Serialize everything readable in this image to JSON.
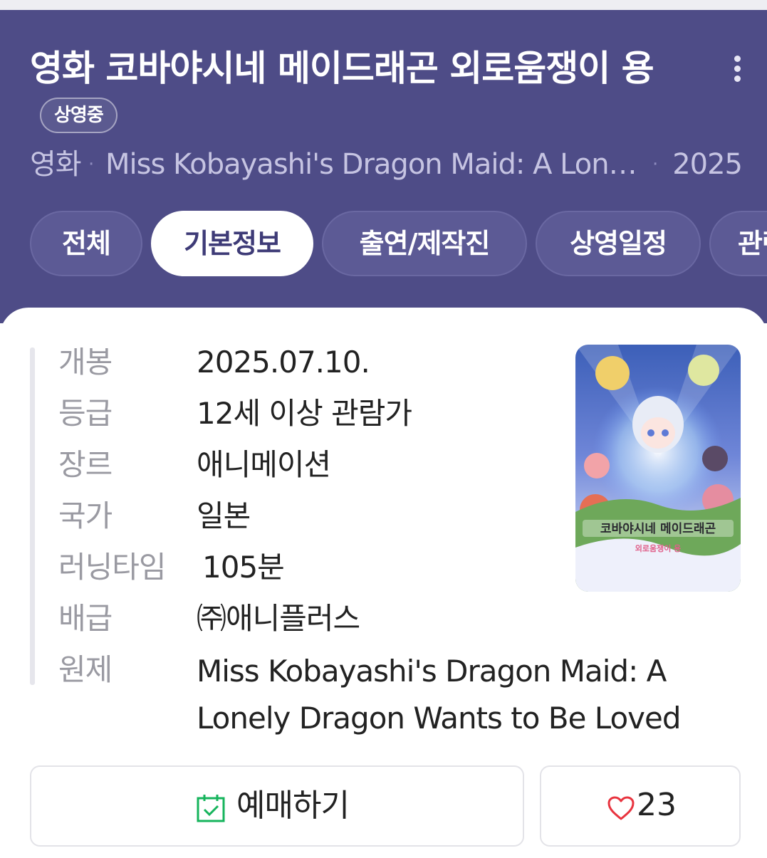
{
  "header": {
    "title": "영화 코바야시네 메이드래곤 외로움쟁이 용",
    "status_badge": "상영중",
    "type": "영화",
    "original_title_short": "Miss Kobayashi's Dragon Maid: A Lonely Dragon Wants to Be Loved",
    "year": "2025",
    "menu_icon": "more-vertical-icon"
  },
  "tabs": [
    {
      "label": "전체",
      "active": false
    },
    {
      "label": "기본정보",
      "active": true
    },
    {
      "label": "출연/제작진",
      "active": false
    },
    {
      "label": "상영일정",
      "active": false
    },
    {
      "label": "관련",
      "active": false
    }
  ],
  "info": {
    "release": {
      "label": "개봉",
      "value": "2025.07.10."
    },
    "rating": {
      "label": "등급",
      "value": "12세 이상 관람가"
    },
    "genre": {
      "label": "장르",
      "value": "애니메이션"
    },
    "country": {
      "label": "국가",
      "value": "일본"
    },
    "runtime": {
      "label": "러닝타임",
      "value": "105분"
    },
    "distributor": {
      "label": "배급",
      "value": "㈜애니플러스"
    },
    "original_title": {
      "label": "원제",
      "value": "Miss Kobayashi's Dragon Maid: A Lonely Dragon Wants to Be Loved"
    }
  },
  "poster": {
    "logo_line1": "코바야시네 메이드래곤",
    "logo_line2": "외로움쟁이 용"
  },
  "actions": {
    "book_label": "예매하기",
    "book_icon": "calendar-check-icon",
    "like_count": "23",
    "like_icon": "heart-outline-icon"
  },
  "colors": {
    "header_bg": "#4e4c87",
    "accent_green": "#16b45c",
    "heart_red": "#e8343f"
  }
}
